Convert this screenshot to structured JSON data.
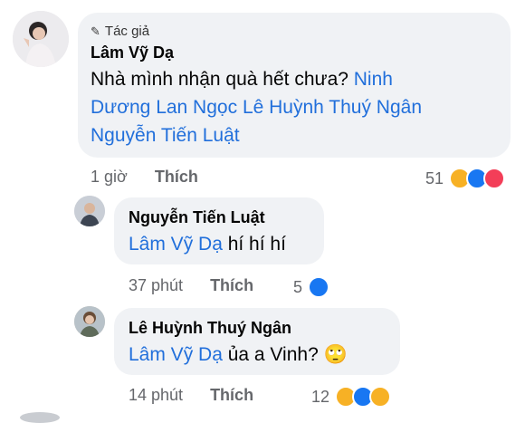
{
  "main_comment": {
    "badge": "Tác giả",
    "name": "Lâm Vỹ Dạ",
    "text_plain": "Nhà mình nhận quà hết chưa? ",
    "mention_1": "Ninh",
    "mention_2": "Dương Lan Ngọc",
    "mention_3": "Lê Huỳnh Thuý Ngân",
    "mention_4": "Nguyễn Tiến Luật",
    "time": "1 giờ",
    "like_label": "Thích",
    "reaction_count": "51",
    "reaction_icons": [
      "haha-icon",
      "like-icon",
      "love-icon"
    ]
  },
  "reply_1": {
    "name": "Nguyễn Tiến Luật",
    "mention": "Lâm Vỹ Dạ",
    "text": " hí hí hí",
    "time": "37 phút",
    "like_label": "Thích",
    "reaction_count": "5",
    "reaction_icons": [
      "like-icon"
    ]
  },
  "reply_2": {
    "name": "Lê Huỳnh Thuý Ngân",
    "mention": "Lâm Vỹ Dạ",
    "text": " ủa a Vinh? ",
    "emoji": "🙄",
    "time": "14 phút",
    "like_label": "Thích",
    "reaction_count": "12",
    "reaction_icons": [
      "haha-icon",
      "like-icon",
      "wow-icon"
    ]
  },
  "colors": {
    "mention": "#216fdb",
    "meta": "#65676b",
    "bubble": "#f0f2f5"
  }
}
